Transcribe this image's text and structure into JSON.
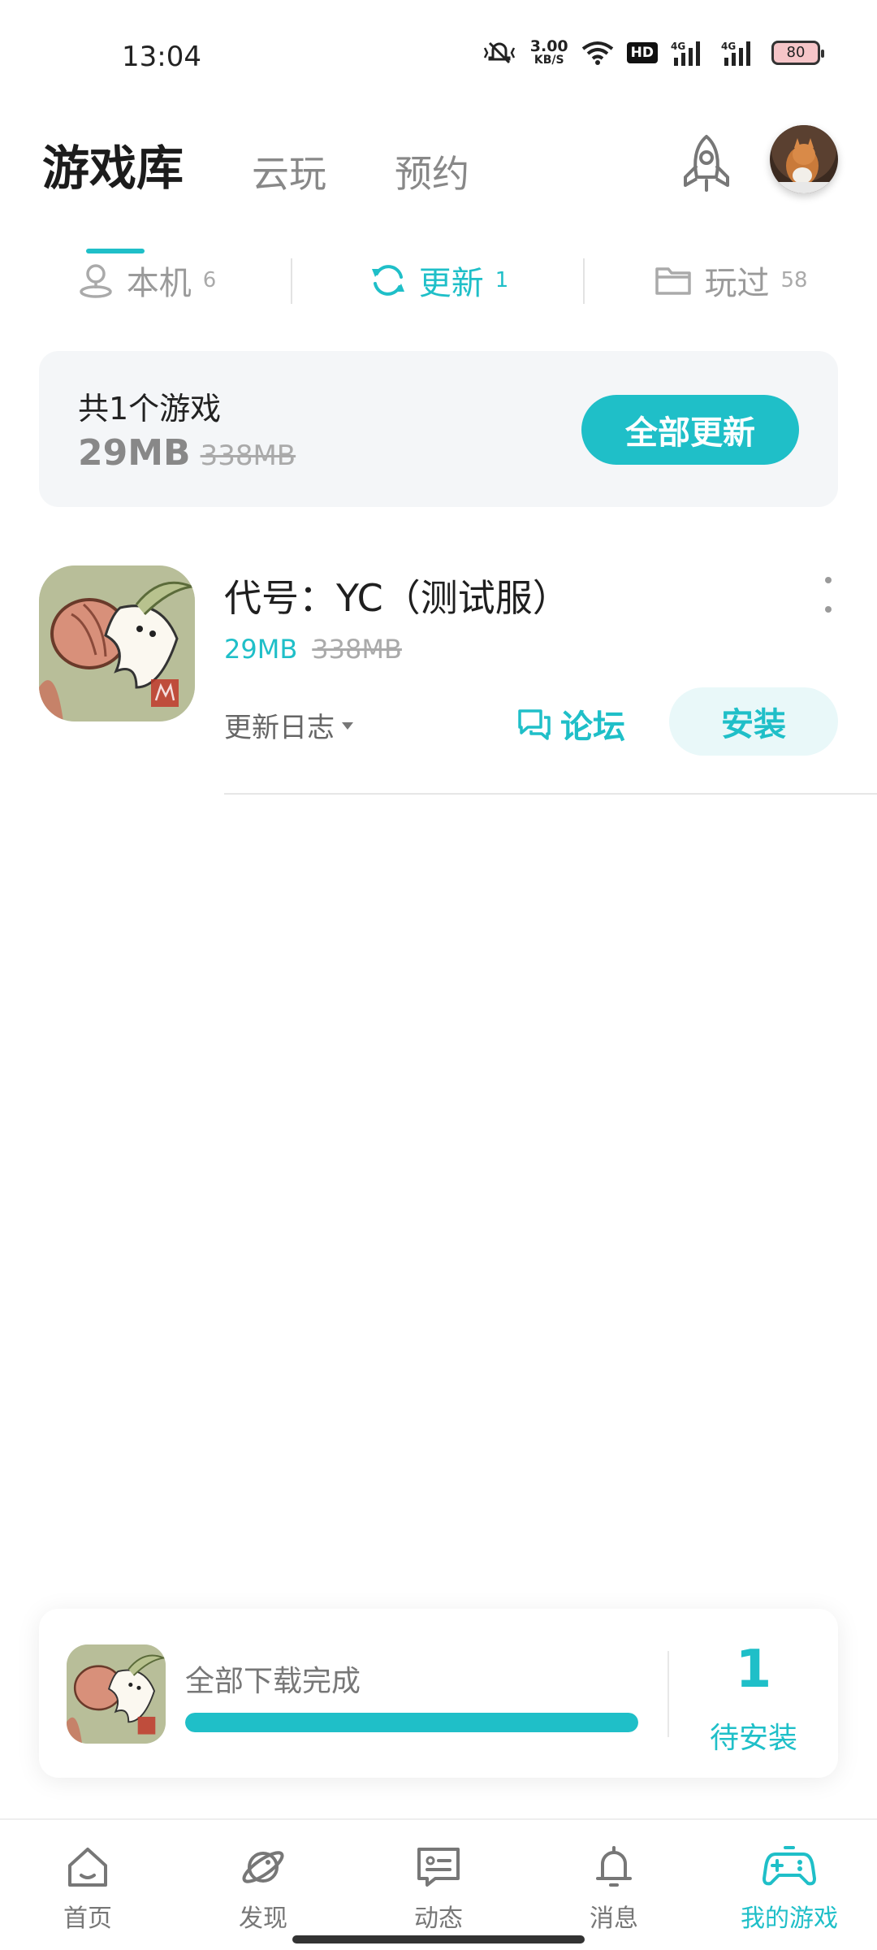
{
  "status": {
    "time": "13:04",
    "speed_value": "3.00",
    "speed_unit": "KB/S",
    "hd": "HD",
    "net1": "4G",
    "net2": "4G",
    "battery": "80"
  },
  "top_tabs": [
    {
      "label": "游戏库",
      "active": true
    },
    {
      "label": "云玩",
      "active": false
    },
    {
      "label": "预约",
      "active": false
    }
  ],
  "segments": [
    {
      "label": "本机",
      "count": "6",
      "icon": "user-pin-icon",
      "active": false
    },
    {
      "label": "更新",
      "count": "1",
      "icon": "refresh-icon",
      "active": true
    },
    {
      "label": "玩过",
      "count": "58",
      "icon": "folder-icon",
      "active": false
    }
  ],
  "summary": {
    "title": "共1个游戏",
    "size_new": "29MB",
    "size_old": "338MB",
    "button": "全部更新"
  },
  "game": {
    "name": "代号：YC（测试服）",
    "size_new": "29MB",
    "size_old": "338MB",
    "changelog": "更新日志",
    "forum": "论坛",
    "install": "安装"
  },
  "download_panel": {
    "status": "全部下载完成",
    "progress": 1.0,
    "count": "1",
    "count_label": "待安装"
  },
  "bottom_nav": [
    {
      "label": "首页",
      "icon": "home-icon",
      "active": false
    },
    {
      "label": "发现",
      "icon": "planet-icon",
      "active": false
    },
    {
      "label": "动态",
      "icon": "chat-card-icon",
      "active": false
    },
    {
      "label": "消息",
      "icon": "bell-icon",
      "active": false
    },
    {
      "label": "我的游戏",
      "icon": "gamepad-icon",
      "active": true
    }
  ],
  "colors": {
    "accent": "#1fbfc8",
    "accent_light": "#e9f8f9"
  }
}
